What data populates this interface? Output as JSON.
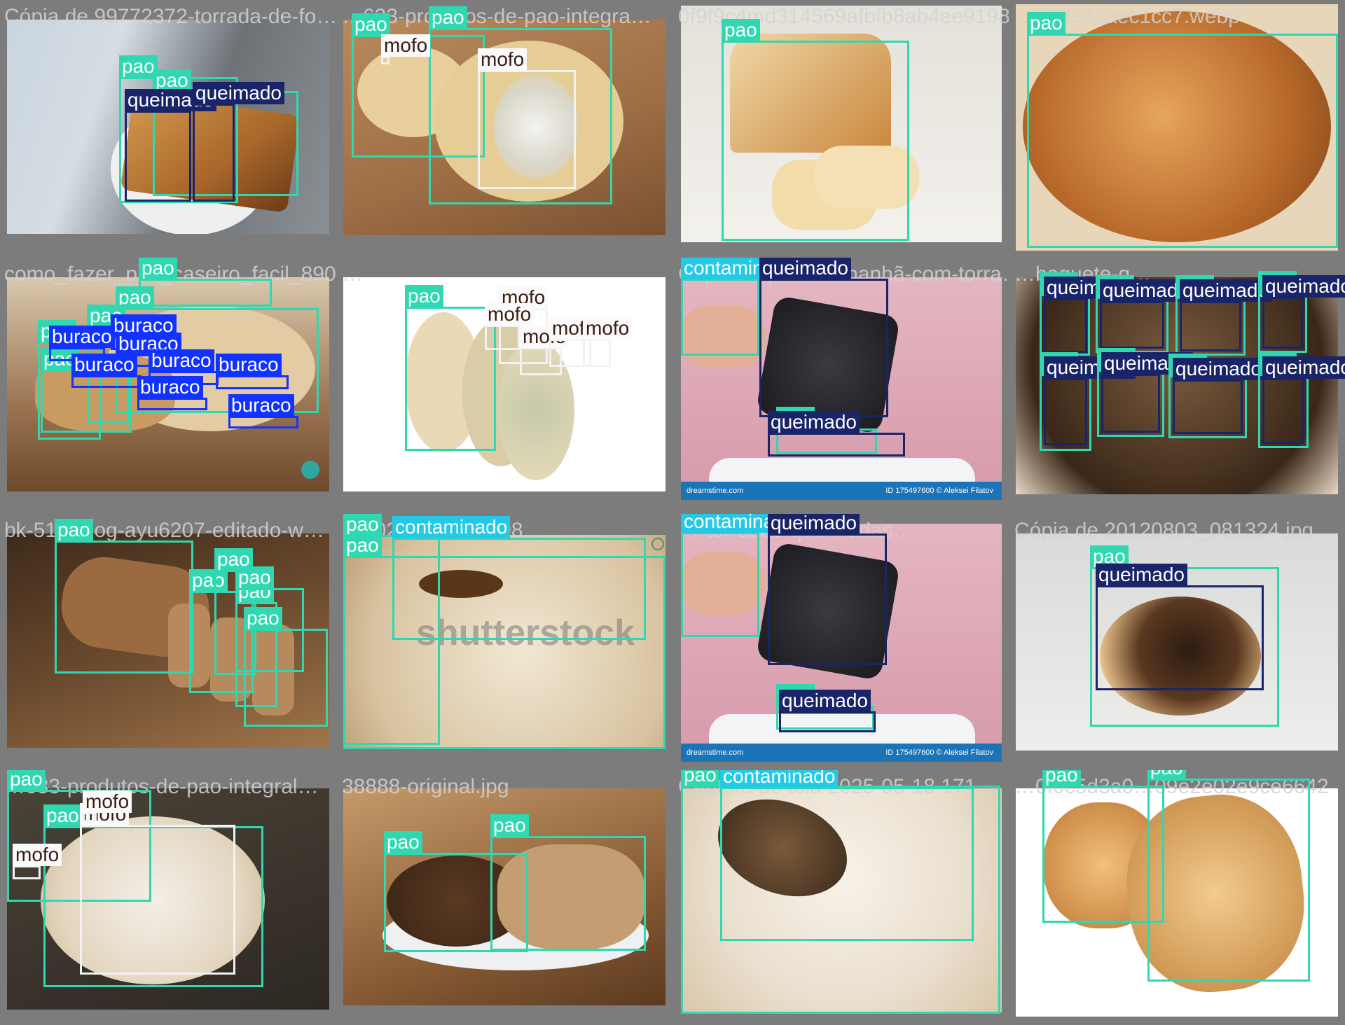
{
  "colors": {
    "pao": "#2fd8b0",
    "queimado": "#1a2468",
    "mofo": "#f2f2f2",
    "buraco": "#1233ff",
    "contaminado": "#24c9e8"
  },
  "tiles": [
    {
      "filename": "Cópia de 99772372-torrada-de-fo…",
      "labels": [
        "pao",
        "pao",
        "queimado",
        "queimado"
      ]
    },
    {
      "filename": "…633-produtos-de-pao-integra…",
      "labels": [
        "pao",
        "pao",
        "mofo",
        "mofo"
      ]
    },
    {
      "filename": "0f9f9c4md314569afbfb8ab4ee9198",
      "labels": [
        "pao"
      ]
    },
    {
      "filename": "…d33342aec1cc7.webp",
      "labels": [
        "pao"
      ]
    },
    {
      "filename": "como_fazer_pao_caseiro_facil_8908309582dfcbc0367b.jpg",
      "labels": [
        "pao",
        "pao",
        "pao",
        "pao",
        "pao",
        "buraco",
        "buraco",
        "buraco",
        "buraco",
        "buraco",
        "buraco",
        "buraco",
        "buraco"
      ]
    },
    {
      "filename": "…",
      "labels": [
        "pao",
        "mofo",
        "mofo",
        "mofo",
        "mofo",
        "mofo"
      ]
    },
    {
      "filename": "Cópia de pao-de-manhã-com-torra…",
      "labels": [
        "contaminado",
        "queimado",
        "pao",
        "queimado"
      ],
      "footer_left": "dreamstime.com",
      "footer_right": "ID 175497600 © Aleksei Filatov"
    },
    {
      "filename": "…baguete-q…",
      "labels": [
        "pao",
        "queimado",
        "pao",
        "queimado",
        "pao",
        "queimado",
        "pao",
        "queimado",
        "pao",
        "queimado",
        "pao",
        "queimado",
        "pao",
        "queimado",
        "pao",
        "queimado"
      ]
    },
    {
      "filename": "bk-51…blog-ayu6207-editado-w…",
      "labels": [
        "pao",
        "pao",
        "pao",
        "pao",
        "pao",
        "pao"
      ]
    },
    {
      "filename": "…2025-05-18 1708…",
      "labels": [
        "pao",
        "pao",
        "contaminado"
      ],
      "watermark": "shutterstock"
    },
    {
      "filename": "…-torradas-queimadas…",
      "labels": [
        "contaminado",
        "queimado",
        "pao",
        "queimado"
      ],
      "footer_left": "dreamstime.com",
      "footer_right": "ID 175497600 © Aleksei Filatov"
    },
    {
      "filename": "Cópia de 20120803_081324.jpg",
      "labels": [
        "pao",
        "queimado"
      ]
    },
    {
      "filename": "…633-produtos-de-pao-integral…",
      "labels": [
        "pao",
        "pao",
        "mofo",
        "mofo",
        "mofo"
      ]
    },
    {
      "filename": "38888-original.jpg",
      "labels": [
        "pao",
        "pao"
      ]
    },
    {
      "filename": "Captura de tela 2025-05-18 171…",
      "labels": [
        "pao",
        "contaminado"
      ]
    },
    {
      "filename": "…0f0c5d3a0…09e2e02e9ce6642",
      "labels": [
        "pao",
        "pao"
      ]
    }
  ]
}
